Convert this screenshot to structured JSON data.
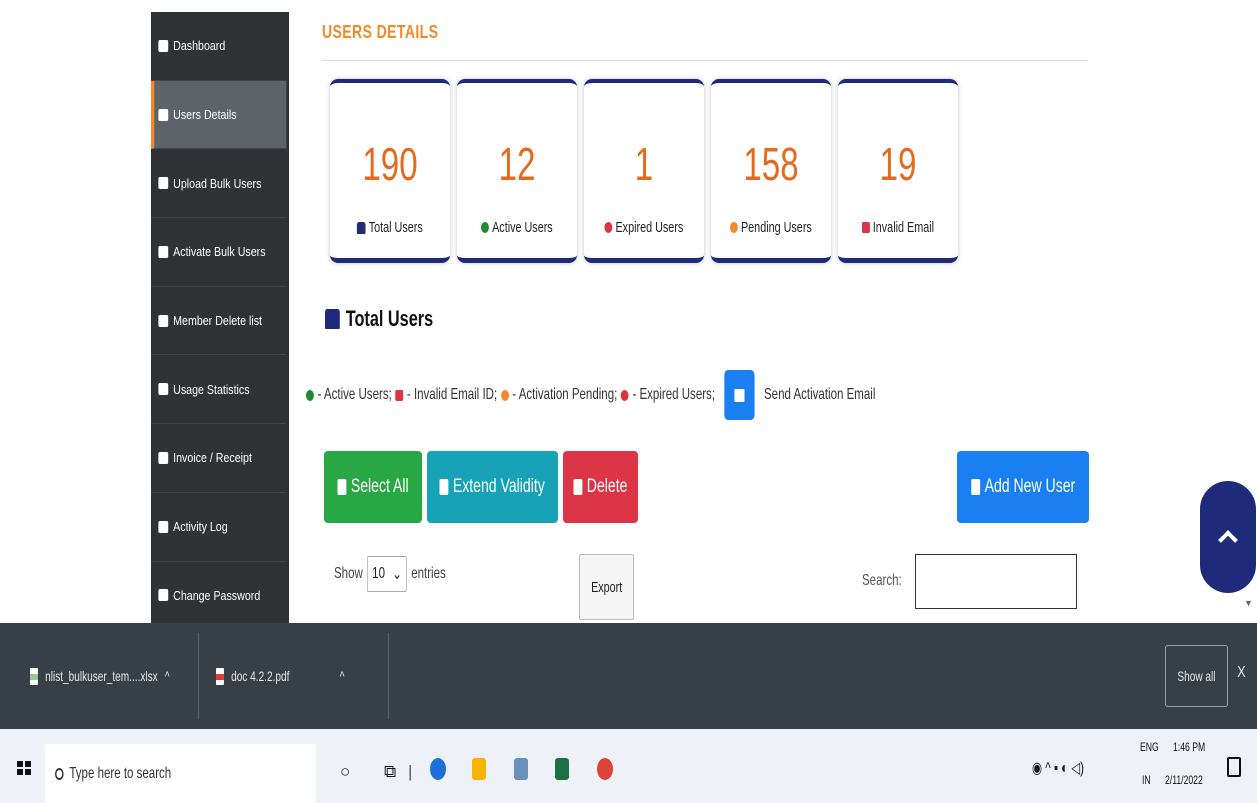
{
  "sidebar": {
    "items": [
      {
        "label": "Dashboard",
        "icon": "dashboard-icon"
      },
      {
        "label": "Users Details",
        "icon": "user-icon",
        "active": true
      },
      {
        "label": "Upload Bulk Users",
        "icon": "users-icon"
      },
      {
        "label": "Activate Bulk Users",
        "icon": "check-square-icon"
      },
      {
        "label": "Member Delete list",
        "icon": "trash-icon"
      },
      {
        "label": "Usage Statistics",
        "icon": "chart-icon"
      },
      {
        "label": "Invoice / Receipt",
        "icon": "lock-icon"
      },
      {
        "label": "Activity Log",
        "icon": "list-icon"
      },
      {
        "label": "Change Password",
        "icon": "key-icon"
      }
    ]
  },
  "page": {
    "title": "USERS DETAILS"
  },
  "stats": [
    {
      "value": "190",
      "label": "Total Users",
      "icon": "users-icon",
      "color": "#1f2a7a"
    },
    {
      "value": "12",
      "label": "Active Users",
      "icon": "check-circle-icon",
      "color": "#1c8a2f"
    },
    {
      "value": "1",
      "label": "Expired Users",
      "icon": "times-circle-icon",
      "color": "#dc3545"
    },
    {
      "value": "158",
      "label": "Pending Users",
      "icon": "clock-icon",
      "color": "#f08a2c"
    },
    {
      "value": "19",
      "label": "Invalid Email",
      "icon": "envelope-icon",
      "color": "#dc3545"
    }
  ],
  "section": {
    "title": "Total Users"
  },
  "legend": {
    "active": "- Active Users;",
    "invalid": "- Invalid Email ID;",
    "pending": "- Activation Pending;",
    "expired": "- Expired Users;",
    "send": "Send Activation Email"
  },
  "actions": {
    "select_all": "Select All",
    "extend_validity": "Extend Validity",
    "delete": "Delete",
    "add_new_user": "Add New User"
  },
  "table_controls": {
    "show_label": "Show",
    "entries_value": "10",
    "entries_label": "entries",
    "export_label": "Export",
    "search_label": "Search:",
    "search_value": ""
  },
  "downloads": {
    "items": [
      {
        "name": "nlist_bulkuser_tem....xlsx"
      },
      {
        "name": "doc 4.2.2.pdf"
      }
    ],
    "show_all": "Show all",
    "close": "X"
  },
  "taskbar": {
    "search_placeholder": "Type here to search",
    "tray_lang_top": "ENG",
    "tray_lang_bottom": "IN",
    "time": "1:46 PM",
    "date": "2/11/2022"
  },
  "colors": {
    "accent": "#f08a2c",
    "navy": "#1f2a7a",
    "sidebar_bg": "#2f3336",
    "green": "#28a745",
    "teal": "#17a2b8",
    "red": "#dc3545",
    "blue": "#1a7ff0"
  }
}
